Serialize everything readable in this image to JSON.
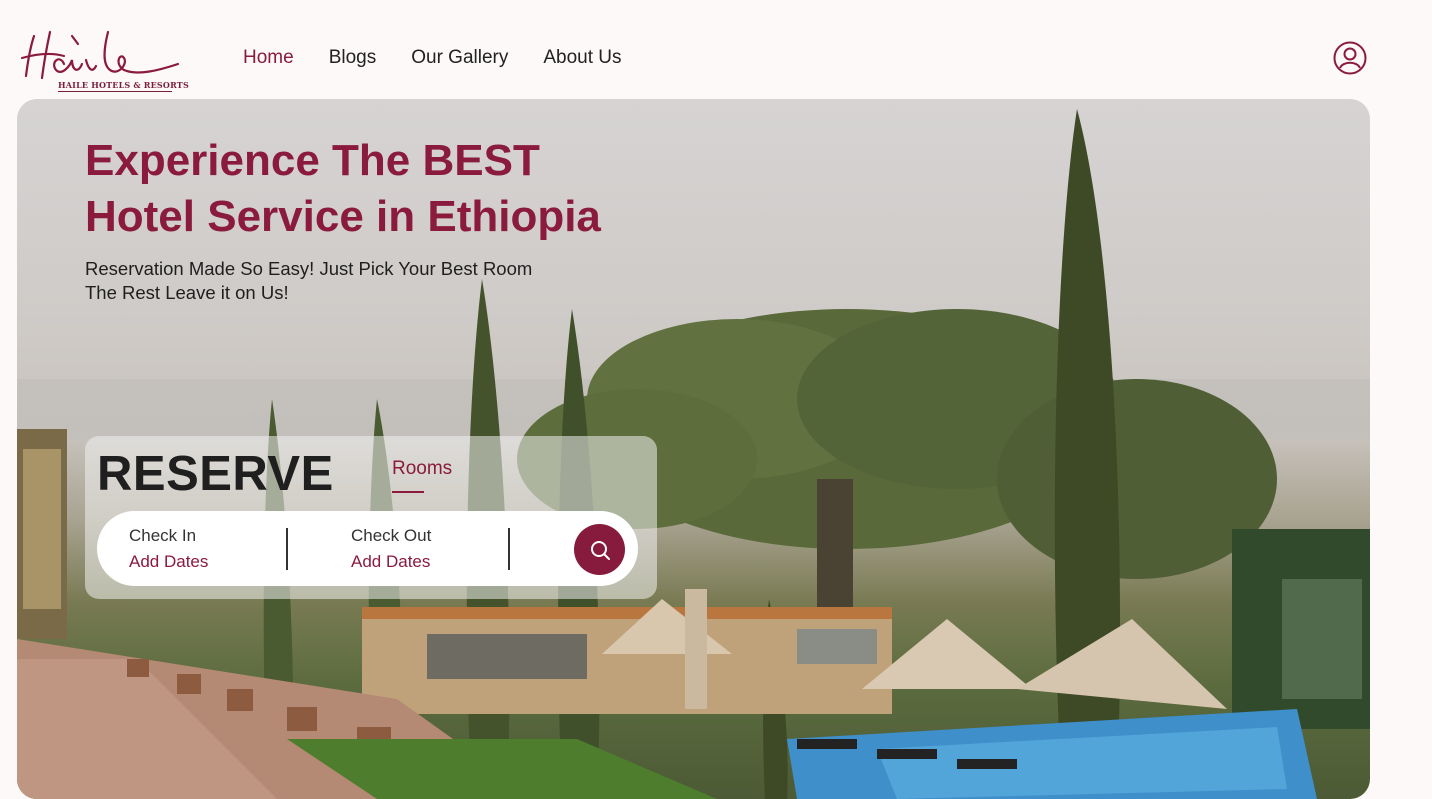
{
  "brand": {
    "logo_caption": "HAILE HOTELS & RESORTS",
    "accent_color": "#8a1a3e"
  },
  "nav": {
    "items": [
      {
        "label": "Home",
        "active": true
      },
      {
        "label": "Blogs",
        "active": false
      },
      {
        "label": "Our Gallery",
        "active": false
      },
      {
        "label": "About Us",
        "active": false
      }
    ],
    "profile_icon": "user-circle-icon"
  },
  "hero": {
    "title_line1": "Experience The BEST",
    "title_line2": "Hotel Service in Ethiopia",
    "subtitle_line1": "Reservation Made So Easy! Just Pick Your Best Room",
    "subtitle_line2": "The Rest Leave it on Us!"
  },
  "reserve": {
    "title": "RESERVE",
    "tab": "Rooms",
    "check_in_label": "Check In",
    "check_in_value": "Add Dates",
    "check_out_label": "Check Out",
    "check_out_value": "Add Dates",
    "search_icon": "search-icon"
  }
}
